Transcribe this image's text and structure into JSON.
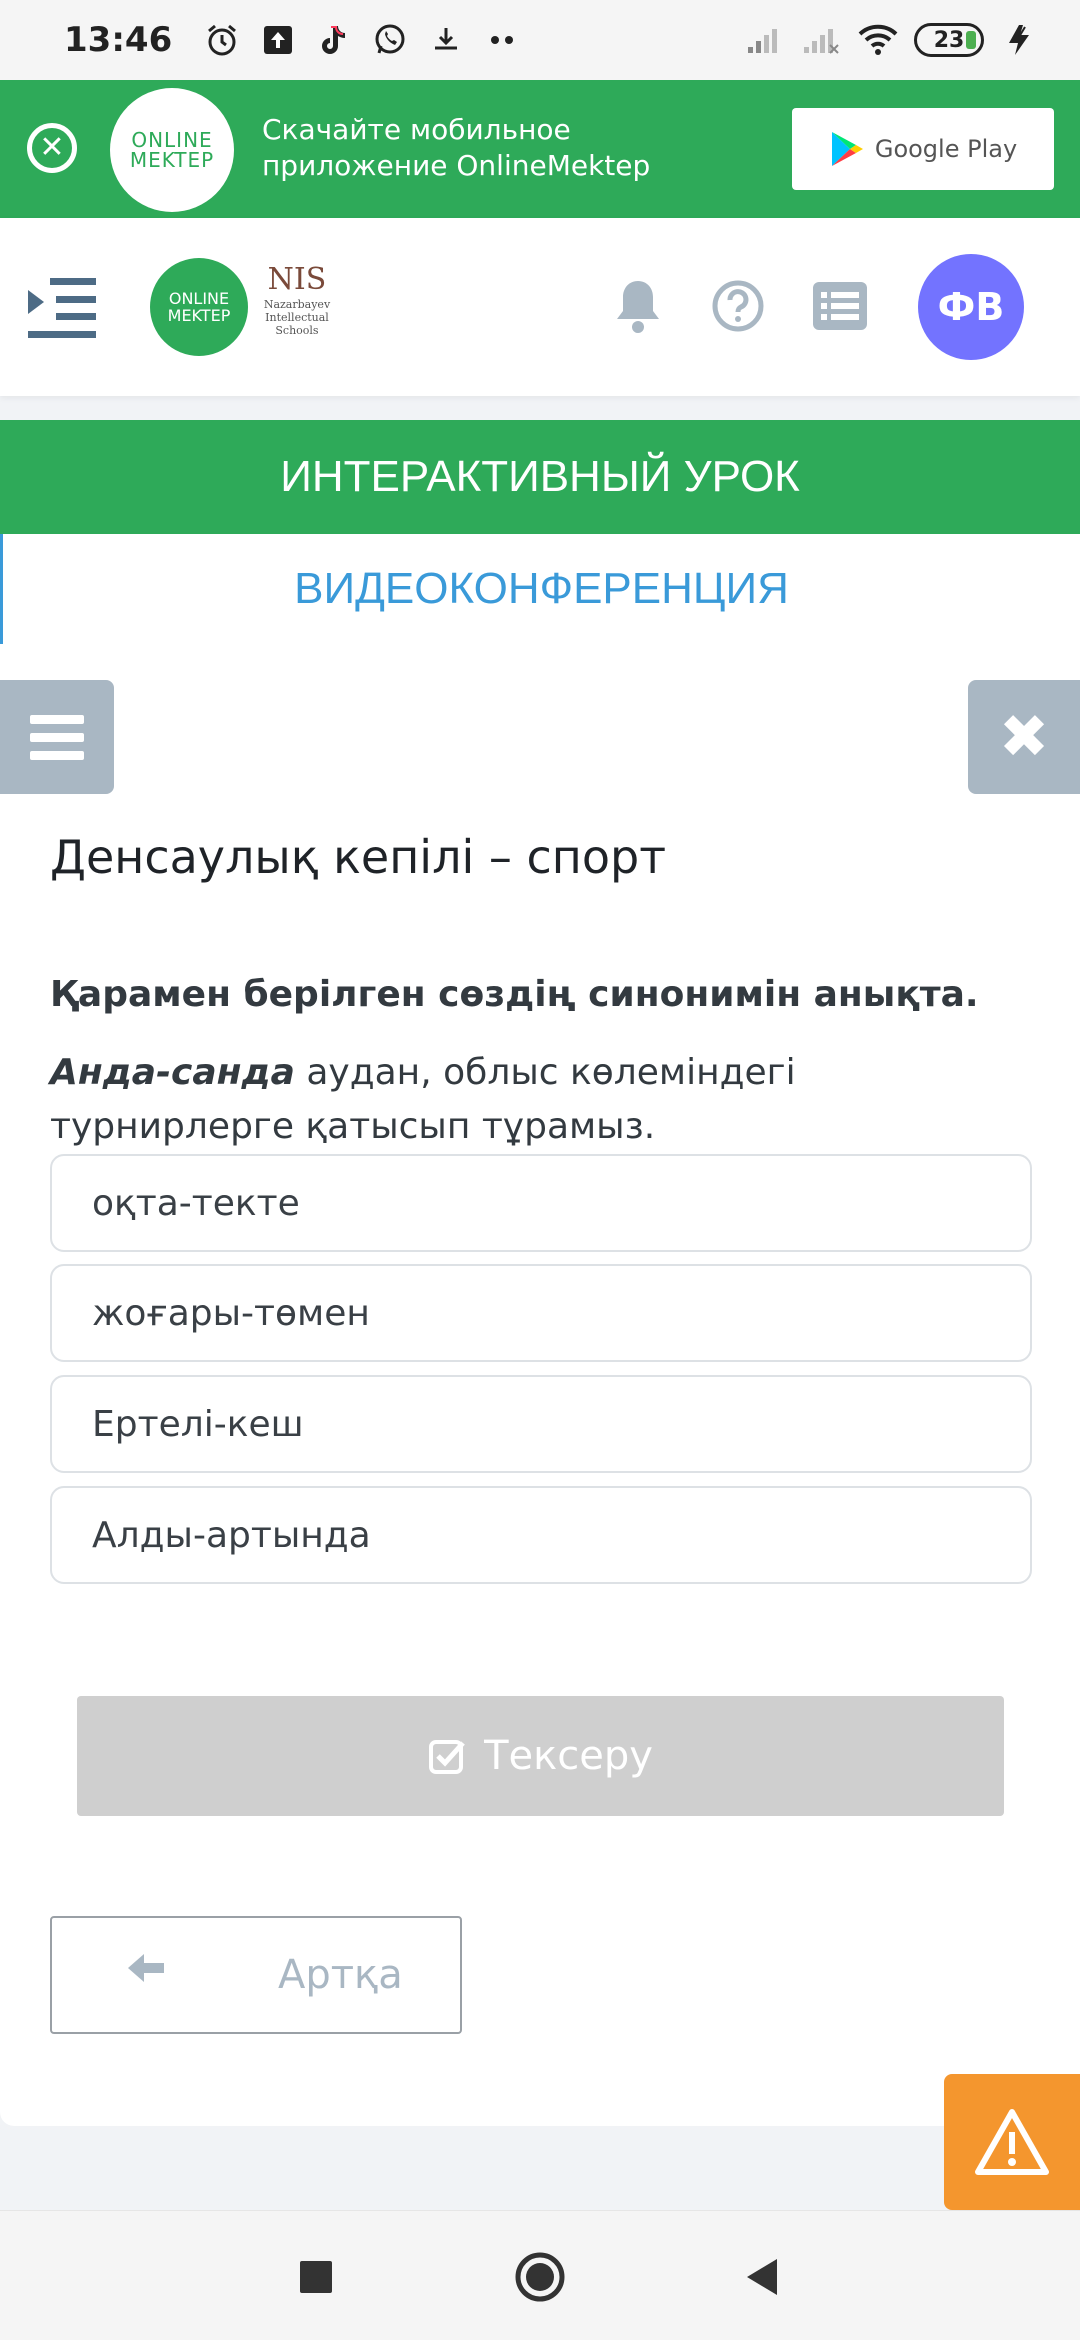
{
  "status_bar": {
    "time": "13:46",
    "battery": "23",
    "icons": [
      "alarm-icon",
      "upload-icon",
      "tiktok-icon",
      "whatsapp-icon",
      "download-icon",
      "more-dots-icon",
      "signal-icon",
      "signal-icon",
      "wifi-icon",
      "charging-icon"
    ]
  },
  "promo": {
    "logo_line1": "ONLINE",
    "logo_line2": "MEKTEP",
    "text": "Скачайте мобильное приложение OnlineMektep",
    "store_label": "Google Play"
  },
  "header": {
    "logo_line1": "ONLINE",
    "logo_line2": "MEKTEP",
    "nis_title": "NIS",
    "nis_line1": "Nazarbayev",
    "nis_line2": "Intellectual",
    "nis_line3": "Schools",
    "avatar_initials": "ФВ"
  },
  "tabs": {
    "interactive": "ИНТЕРАКТИВНЫЙ УРОК",
    "video": "ВИДЕОКОНФЕРЕНЦИЯ"
  },
  "lesson": {
    "title": "Денсаулық кепілі – спорт",
    "question": "Қарамен берілген сөздің синонимін анықта.",
    "sentence_bold": "Анда-санда",
    "sentence_rest": " аудан, облыс көлеміндегі турнирлерге қатысып тұрамыз.",
    "options": [
      "оқта-текте",
      "жоғары-төмен",
      "Ертелі-кеш",
      "Алды-артында"
    ],
    "check_label": "Тексеру",
    "back_label": "Артқа"
  },
  "colors": {
    "brand_green": "#2eaa59",
    "link_blue": "#3a9ad9",
    "avatar_purple": "#7373ff",
    "warning_orange": "#f4962e",
    "muted_gray": "#a9b7c3"
  }
}
